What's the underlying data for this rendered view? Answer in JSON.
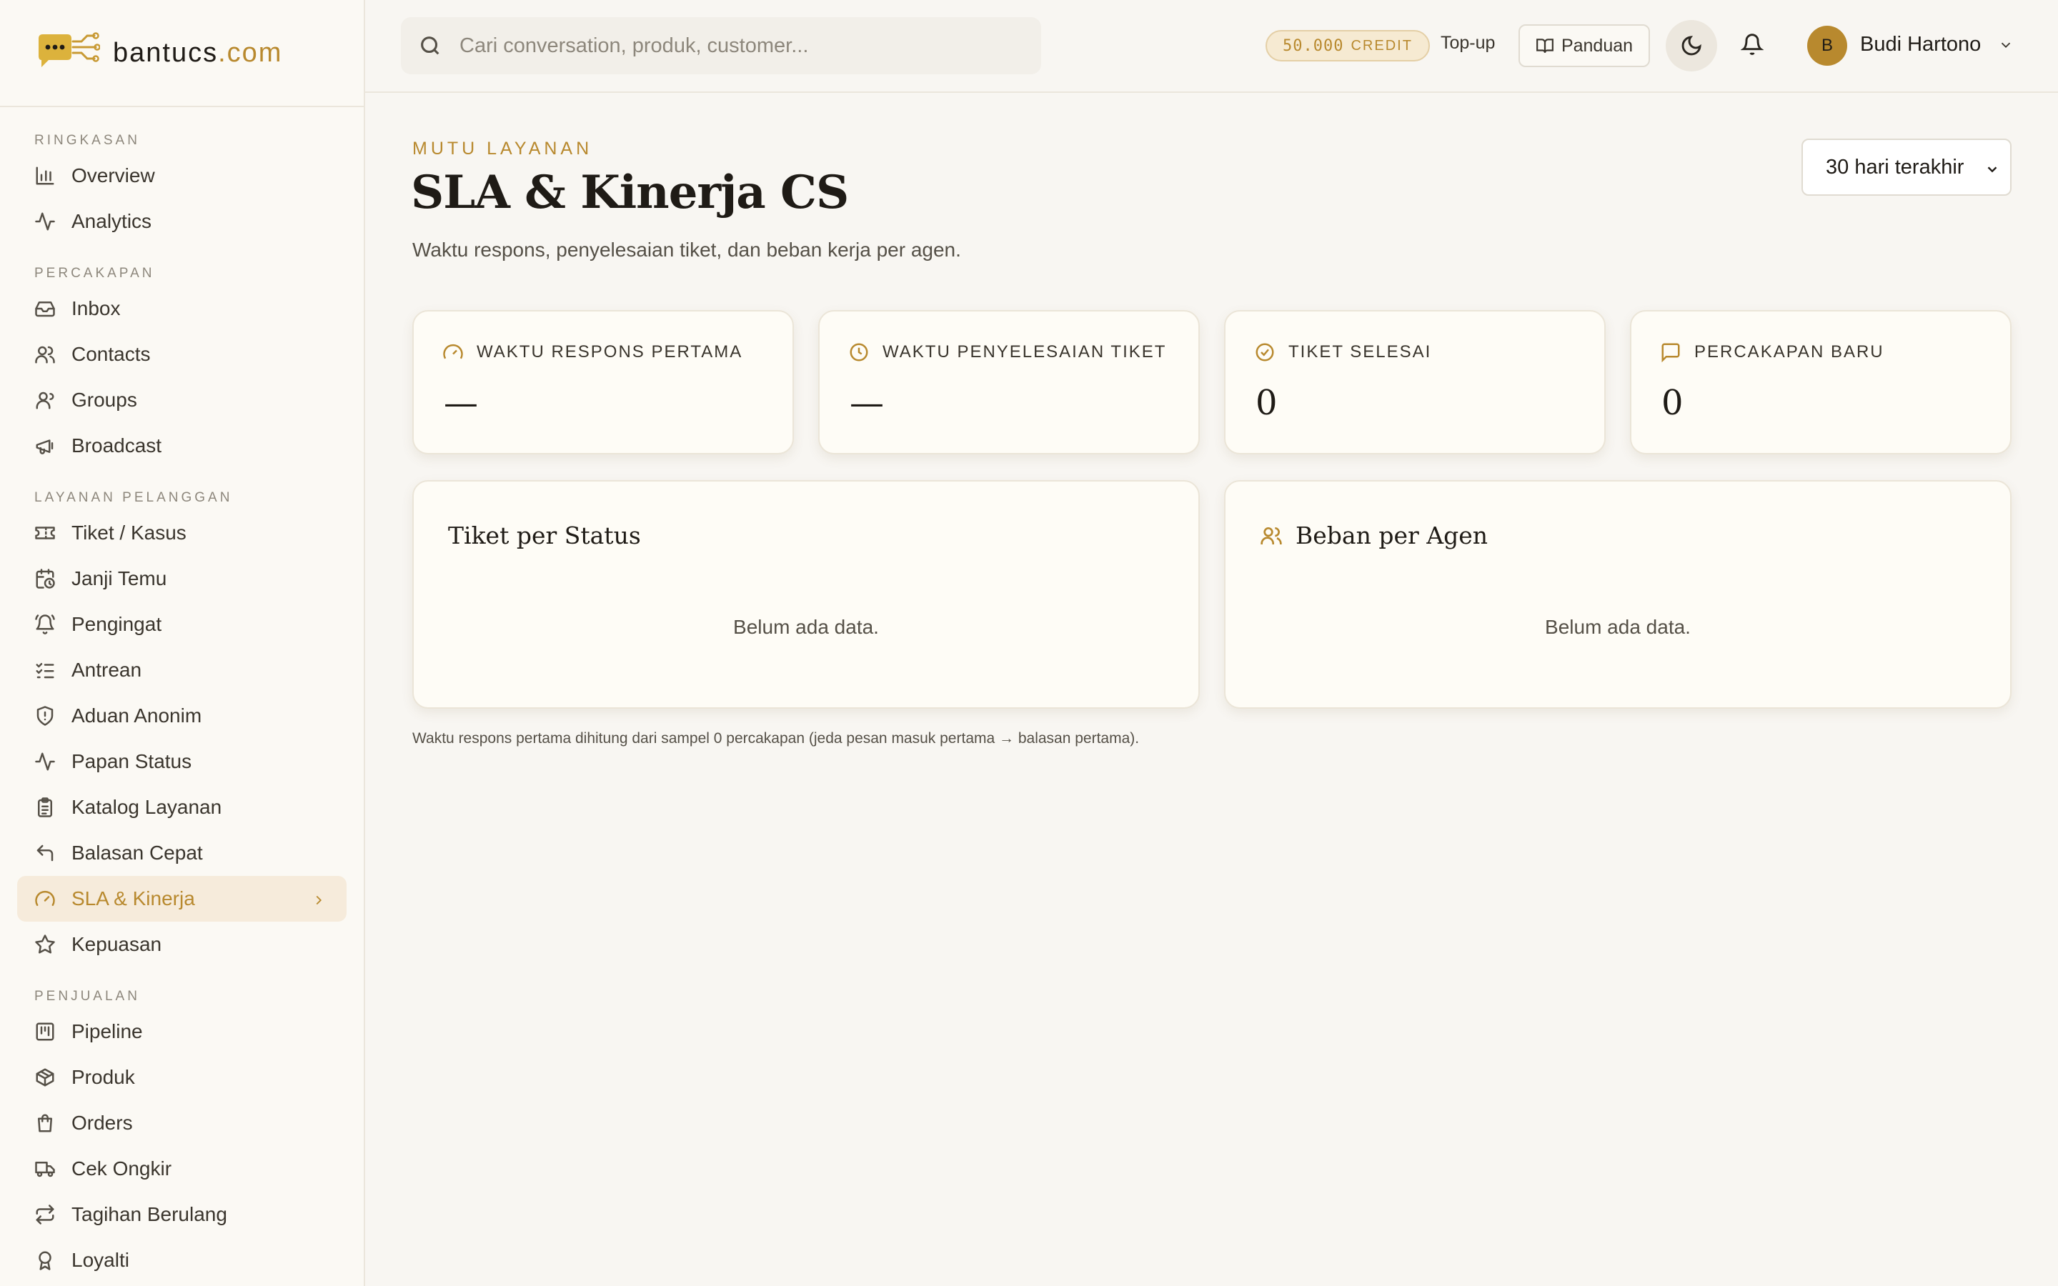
{
  "brand": {
    "name": "bantucs",
    "tld": ".com"
  },
  "search": {
    "placeholder": "Cari conversation, produk, customer..."
  },
  "topbar": {
    "credit_amount": "50.000",
    "credit_label": "CREDIT",
    "topup_label": "Top-up",
    "panduan_label": "Panduan",
    "user_initial": "B",
    "user_name": "Budi Hartono"
  },
  "sidebar": {
    "sections": [
      {
        "title": "RINGKASAN",
        "items": [
          {
            "label": "Overview",
            "icon": "chart-bar-icon"
          },
          {
            "label": "Analytics",
            "icon": "activity-icon"
          }
        ]
      },
      {
        "title": "PERCAKAPAN",
        "items": [
          {
            "label": "Inbox",
            "icon": "inbox-icon"
          },
          {
            "label": "Contacts",
            "icon": "users-icon"
          },
          {
            "label": "Groups",
            "icon": "user-group-icon"
          },
          {
            "label": "Broadcast",
            "icon": "megaphone-icon"
          }
        ]
      },
      {
        "title": "LAYANAN PELANGGAN",
        "items": [
          {
            "label": "Tiket / Kasus",
            "icon": "ticket-icon"
          },
          {
            "label": "Janji Temu",
            "icon": "calendar-clock-icon"
          },
          {
            "label": "Pengingat",
            "icon": "bell-ring-icon"
          },
          {
            "label": "Antrean",
            "icon": "list-checks-icon"
          },
          {
            "label": "Aduan Anonim",
            "icon": "shield-icon"
          },
          {
            "label": "Papan Status",
            "icon": "activity-icon"
          },
          {
            "label": "Katalog Layanan",
            "icon": "clipboard-icon"
          },
          {
            "label": "Balasan Cepat",
            "icon": "reply-icon"
          },
          {
            "label": "SLA & Kinerja",
            "icon": "gauge-icon",
            "active": true
          },
          {
            "label": "Kepuasan",
            "icon": "star-icon"
          }
        ]
      },
      {
        "title": "PENJUALAN",
        "items": [
          {
            "label": "Pipeline",
            "icon": "kanban-icon"
          },
          {
            "label": "Produk",
            "icon": "package-icon"
          },
          {
            "label": "Orders",
            "icon": "shopping-bag-icon"
          },
          {
            "label": "Cek Ongkir",
            "icon": "truck-icon"
          },
          {
            "label": "Tagihan Berulang",
            "icon": "repeat-icon"
          },
          {
            "label": "Loyalti",
            "icon": "award-icon"
          }
        ]
      }
    ]
  },
  "page": {
    "eyebrow": "MUTU LAYANAN",
    "title": "SLA & Kinerja CS",
    "subtitle": "Waktu respons, penyelesaian tiket, dan beban kerja per agen.",
    "range_selected": "30 hari terakhir"
  },
  "stats": [
    {
      "label": "WAKTU RESPONS PERTAMA",
      "value": "—",
      "icon": "gauge-icon"
    },
    {
      "label": "WAKTU PENYELESAIAN TIKET",
      "value": "—",
      "icon": "clock-icon"
    },
    {
      "label": "TIKET SELESAI",
      "value": "0",
      "icon": "check-circle-icon"
    },
    {
      "label": "PERCAKAPAN BARU",
      "value": "0",
      "icon": "message-square-icon"
    }
  ],
  "panels": {
    "status": {
      "title": "Tiket per Status",
      "empty": "Belum ada data."
    },
    "agent": {
      "title": "Beban per Agen",
      "empty": "Belum ada data."
    }
  },
  "footnote": "Waktu respons pertama dihitung dari sampel 0 percakapan (jeda pesan masuk pertama → balasan pertama).",
  "colors": {
    "accent": "#b8892e",
    "active_bg": "#f6ebdb",
    "background": "#f8f6f2",
    "card": "#fefcf6"
  }
}
